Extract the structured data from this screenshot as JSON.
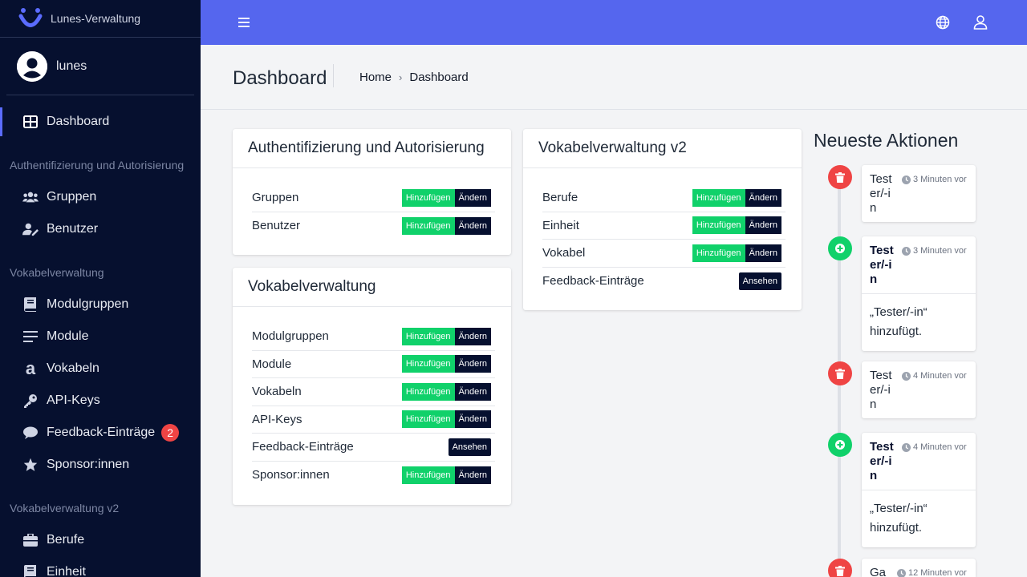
{
  "brand": {
    "name": "Lunes-Verwaltung"
  },
  "user": {
    "name": "lunes"
  },
  "sidebar": {
    "dashboard": "Dashboard",
    "sections": [
      {
        "header": "Authentifizierung und Autorisierung",
        "items": [
          {
            "label": "Gruppen",
            "icon": "users-icon"
          },
          {
            "label": "Benutzer",
            "icon": "user-edit-icon"
          }
        ]
      },
      {
        "header": "Vokabelverwaltung",
        "items": [
          {
            "label": "Modulgruppen",
            "icon": "book-icon"
          },
          {
            "label": "Module",
            "icon": "list-icon"
          },
          {
            "label": "Vokabeln",
            "icon": "letter-a-icon"
          },
          {
            "label": "API-Keys",
            "icon": "key-icon"
          },
          {
            "label": "Feedback-Einträge",
            "icon": "comment-icon",
            "badge": "2"
          },
          {
            "label": "Sponsor:innen",
            "icon": "star-icon"
          }
        ]
      },
      {
        "header": "Vokabelverwaltung v2",
        "items": [
          {
            "label": "Berufe",
            "icon": "briefcase-icon"
          },
          {
            "label": "Einheit",
            "icon": "book-icon"
          }
        ]
      }
    ]
  },
  "header": {
    "title": "Dashboard",
    "breadcrumb": {
      "home": "Home",
      "sep": "›",
      "current": "Dashboard"
    }
  },
  "buttons": {
    "add": "Hinzufügen",
    "edit": "Ändern",
    "view": "Ansehen"
  },
  "cards": [
    {
      "title": "Authentifizierung und Autorisierung",
      "rows": [
        {
          "label": "Gruppen",
          "mode": "add-edit"
        },
        {
          "label": "Benutzer",
          "mode": "add-edit"
        }
      ]
    },
    {
      "title": "Vokabelverwaltung",
      "rows": [
        {
          "label": "Modulgruppen",
          "mode": "add-edit"
        },
        {
          "label": "Module",
          "mode": "add-edit"
        },
        {
          "label": "Vokabeln",
          "mode": "add-edit"
        },
        {
          "label": "API-Keys",
          "mode": "add-edit"
        },
        {
          "label": "Feedback-Einträge",
          "mode": "view"
        },
        {
          "label": "Sponsor:innen",
          "mode": "add-edit"
        }
      ]
    },
    {
      "title": "Vokabelverwaltung v2",
      "rows": [
        {
          "label": "Berufe",
          "mode": "add-edit"
        },
        {
          "label": "Einheit",
          "mode": "add-edit"
        },
        {
          "label": "Vokabel",
          "mode": "add-edit"
        },
        {
          "label": "Feedback-Einträge",
          "mode": "view"
        }
      ]
    }
  ],
  "timeline": {
    "title": "Neueste Aktionen",
    "entries": [
      {
        "type": "delete",
        "object": "Tester/-in",
        "time": "3 Minuten vor",
        "message": ""
      },
      {
        "type": "add",
        "object": "Tester/-in",
        "time": "3 Minuten vor",
        "message": "„Tester/-in“ hinzufügt."
      },
      {
        "type": "delete",
        "object": "Tester/-in",
        "time": "4 Minuten vor",
        "message": ""
      },
      {
        "type": "add",
        "object": "Tester/-in",
        "time": "4 Minuten vor",
        "message": "„Tester/-in“ hinzufügt."
      },
      {
        "type": "delete",
        "object": "Ga",
        "time": "12 Minuten vor",
        "message": ""
      }
    ]
  },
  "colors": {
    "sidebar": "#06102f",
    "topbar": "#5566ee",
    "add": "#10d16a",
    "delete": "#ef4444"
  }
}
